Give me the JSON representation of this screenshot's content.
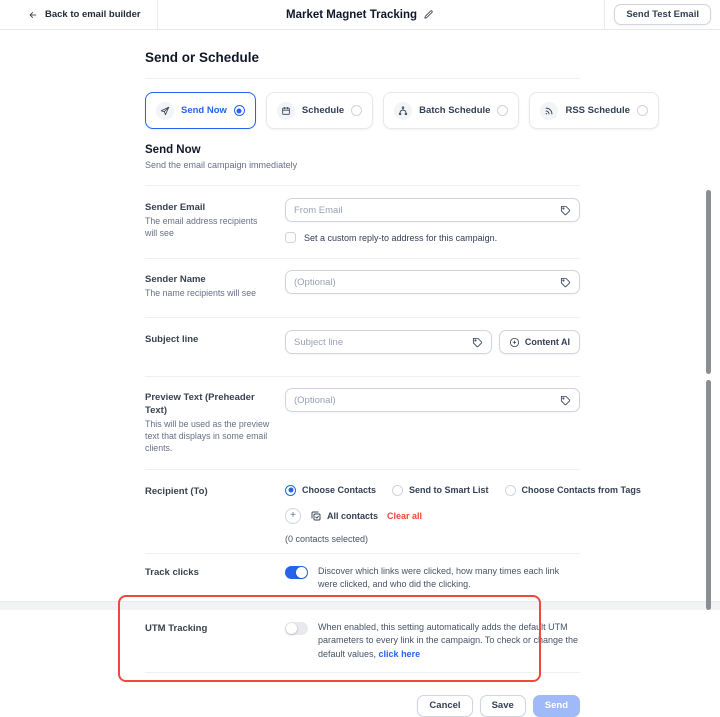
{
  "colors": {
    "primary": "#2563eb",
    "annotation_red": "#f0483c",
    "danger": "#f04438",
    "link": "#2563eb",
    "send_button_disabled": "#a0b9f8",
    "toggle_off": "#e7e9ee"
  },
  "icons": {
    "back": "arrow-left",
    "edit": "pencil",
    "send_now": "paper-plane",
    "schedule": "calendar",
    "batch_schedule": "branch-tree",
    "rss_schedule": "rss",
    "merge_tag": "tag",
    "content_ai": "sparkle-circle",
    "add_contact": "plus",
    "all_contacts": "copy-check"
  },
  "top_bar": {
    "back_label": "Back to email builder",
    "title": "Market Magnet Tracking",
    "send_test_label": "Send Test Email"
  },
  "panel": {
    "title": "Send or Schedule"
  },
  "tabs": [
    {
      "label": "Send Now",
      "selected": true
    },
    {
      "label": "Schedule",
      "selected": false
    },
    {
      "label": "Batch Schedule",
      "selected": false
    },
    {
      "label": "RSS Schedule",
      "selected": false
    }
  ],
  "section": {
    "title": "Send Now",
    "subtitle": "Send the email campaign immediately"
  },
  "fields": {
    "sender_email": {
      "label": "Sender Email",
      "sublabel": "The email address recipients will see",
      "placeholder": "From Email",
      "checkbox_label": "Set a custom reply-to address for this campaign."
    },
    "sender_name": {
      "label": "Sender Name",
      "sublabel": "The name recipients will see",
      "placeholder": "(Optional)"
    },
    "subject": {
      "label": "Subject line",
      "placeholder": "Subject line",
      "content_ai_label": "Content AI"
    },
    "preview_text": {
      "label": "Preview Text (Preheader Text)",
      "sublabel": "This will be used as the preview text that displays in some email clients.",
      "placeholder": "(Optional)"
    },
    "recipient": {
      "label": "Recipient (To)",
      "options": [
        "Choose Contacts",
        "Send to Smart List",
        "Choose Contacts from Tags"
      ],
      "selected_option": "Choose Contacts",
      "add_label": "+",
      "chip_label": "All contacts",
      "clear_all_label": "Clear all",
      "selected_count_text": "(0 contacts selected)"
    },
    "track_clicks": {
      "label": "Track clicks",
      "enabled": true,
      "description": "Discover which links were clicked, how many times each link were clicked, and who did the clicking."
    },
    "utm_tracking": {
      "label": "UTM Tracking",
      "enabled": false,
      "description": "When enabled, this setting automatically adds the default UTM parameters to every link in the campaign. To check or change the default values, ",
      "link_label": "click here"
    }
  },
  "footer": {
    "cancel_label": "Cancel",
    "save_label": "Save",
    "send_label": "Send"
  }
}
